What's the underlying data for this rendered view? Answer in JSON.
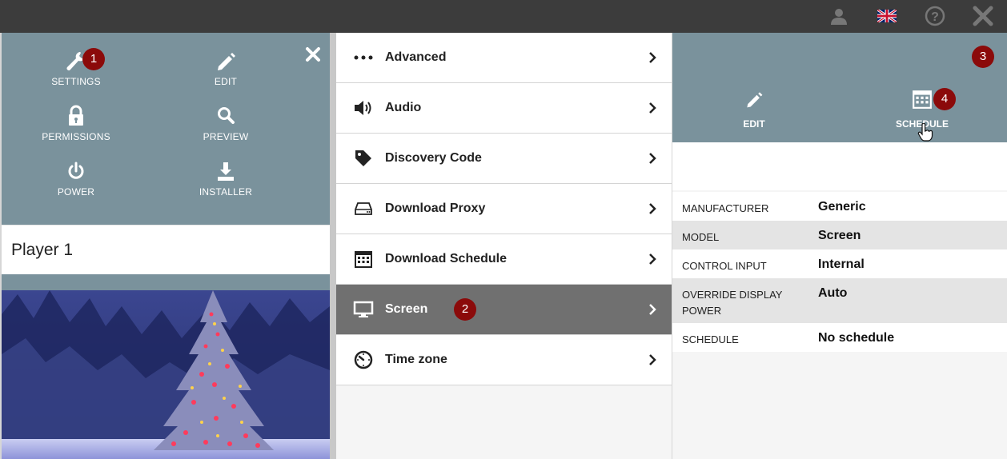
{
  "topbar": {
    "icons": [
      "user-icon",
      "uk-flag-icon",
      "help-icon",
      "close-icon"
    ]
  },
  "left_panel": {
    "tools": [
      {
        "label": "SETTINGS",
        "icon": "wrench-icon"
      },
      {
        "label": "EDIT",
        "icon": "pencil-icon"
      },
      {
        "label": "PERMISSIONS",
        "icon": "lock-icon"
      },
      {
        "label": "PREVIEW",
        "icon": "search-icon"
      },
      {
        "label": "POWER",
        "icon": "power-icon"
      },
      {
        "label": "INSTALLER",
        "icon": "download-icon"
      }
    ],
    "player_name": "Player 1",
    "image": "christmas-tree-photo"
  },
  "menu": {
    "items": [
      {
        "label": "Advanced",
        "icon": "ellipsis-icon",
        "active": false
      },
      {
        "label": "Audio",
        "icon": "speaker-icon",
        "active": false
      },
      {
        "label": "Discovery Code",
        "icon": "tag-icon",
        "active": false
      },
      {
        "label": "Download Proxy",
        "icon": "hard-drive-icon",
        "active": false
      },
      {
        "label": "Download Schedule",
        "icon": "calendar-icon",
        "active": false
      },
      {
        "label": "Screen",
        "icon": "monitor-icon",
        "active": true
      },
      {
        "label": "Time zone",
        "icon": "clock-icon",
        "active": false
      }
    ]
  },
  "right_panel": {
    "actions": [
      {
        "label": "EDIT",
        "icon": "pencil-icon"
      },
      {
        "label": "SCHEDULE",
        "icon": "calendar-icon"
      }
    ],
    "properties": [
      {
        "key": "MANUFACTURER",
        "value": "Generic"
      },
      {
        "key": "MODEL",
        "value": "Screen"
      },
      {
        "key": "CONTROL INPUT",
        "value": "Internal"
      },
      {
        "key": "OVERRIDE DISPLAY POWER",
        "value": "Auto"
      },
      {
        "key": "SCHEDULE",
        "value": "No schedule"
      }
    ]
  },
  "badges": [
    "1",
    "2",
    "3",
    "4"
  ],
  "colors": {
    "topbar": "#3c3c3c",
    "panel_accent": "#7a929c",
    "active_item": "#707070",
    "badge": "#8b0a0a"
  }
}
